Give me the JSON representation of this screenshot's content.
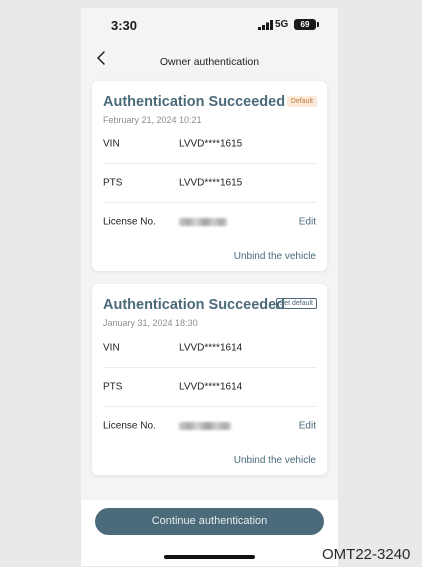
{
  "status_bar": {
    "time": "3:30",
    "network": "5G",
    "battery": "69"
  },
  "nav": {
    "title": "Owner authentication"
  },
  "cards": [
    {
      "title": "Authentication Succeeded",
      "badge": "Default",
      "date": "February 21, 2024 10:21",
      "rows": [
        {
          "label": "VIN",
          "value": "LVVD****1615"
        },
        {
          "label": "PTS",
          "value": "LVVD****1615"
        },
        {
          "label": "License No.",
          "action": "Edit"
        }
      ],
      "unbind": "Unbind the vehicle"
    },
    {
      "title": "Authentication Succeeded",
      "badge": "Set default",
      "date": "January 31, 2024 18:30",
      "rows": [
        {
          "label": "VIN",
          "value": "LVVD****1614"
        },
        {
          "label": "PTS",
          "value": "LVVD****1614"
        },
        {
          "label": "License No.",
          "action": "Edit"
        }
      ],
      "unbind": "Unbind the vehicle"
    }
  ],
  "cta": {
    "label": "Continue authentication"
  },
  "figure_code": "OMT22-3240",
  "colors": {
    "accent": "#4b6a7a",
    "default_badge_bg": "#fbe9da",
    "default_badge_text": "#c07a3a"
  }
}
